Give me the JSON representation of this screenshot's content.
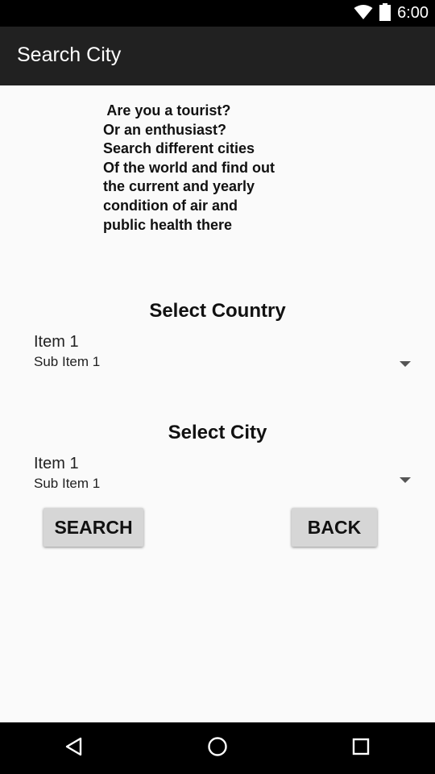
{
  "status_bar": {
    "time": "6:00",
    "icons": [
      "wifi-icon",
      "battery-icon"
    ]
  },
  "app_bar": {
    "title": "Search City"
  },
  "intro": {
    "lines": [
      " Are you a tourist?",
      "Or an enthusiast?",
      "Search different cities",
      "Of the world and find out",
      "the current and yearly",
      "condition of air and",
      "public health there"
    ]
  },
  "country": {
    "label": "Select Country",
    "selected_item": "Item 1",
    "selected_sub_item": "Sub Item 1"
  },
  "city": {
    "label": "Select City",
    "selected_item": "Item 1",
    "selected_sub_item": "Sub Item 1"
  },
  "buttons": {
    "search": "SEARCH",
    "back": "BACK"
  },
  "nav_bar": {
    "icons": [
      "back-icon",
      "home-icon",
      "recents-icon"
    ]
  },
  "colors": {
    "status_bar": "#000000",
    "app_bar": "#212121",
    "background": "#fafafa",
    "button": "#d6d6d6"
  }
}
